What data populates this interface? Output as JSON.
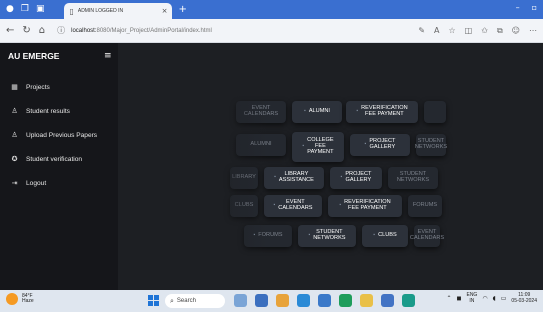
{
  "browser": {
    "tab_title": "ADMIN LOGGED IN",
    "new_tab_symbol": "+",
    "url_host": "localhost:",
    "url_path": "8080/Major_Project/AdminPortal/index.html"
  },
  "sidebar": {
    "brand": "AU EMERGE",
    "items": [
      {
        "icon": "grid-icon",
        "glyph": "▦",
        "label": "Projects"
      },
      {
        "icon": "user-icon",
        "glyph": "♙",
        "label": "Student results"
      },
      {
        "icon": "user-upload-icon",
        "glyph": "♙",
        "label": "Upload Previous Papers"
      },
      {
        "icon": "verify-icon",
        "glyph": "✪",
        "label": "Student verification"
      },
      {
        "icon": "logout-icon",
        "glyph": "⇥",
        "label": "Logout"
      }
    ]
  },
  "tiles": [
    {
      "label": "EVENT\nCALENDARS",
      "dim": true
    },
    {
      "label": "ALUMNI",
      "dim": false
    },
    {
      "label": "REVERIFICATION\nFEE PAYMENT",
      "dim": false
    },
    {
      "label": "ALUMNI",
      "dim": true
    },
    {
      "label": "COLLEGE\nFEE\nPAYMENT",
      "dim": false
    },
    {
      "label": "PROJECT\nGALLERY",
      "dim": false
    },
    {
      "label": "STUDENT\nNETWORKS",
      "dim": true
    },
    {
      "label": "LIBRARY",
      "dim": true
    },
    {
      "label": "LIBRARY\nASSISTANCE",
      "dim": false
    },
    {
      "label": "PROJECT\nGALLERY",
      "dim": false
    },
    {
      "label": "STUDENT\nNETWORKS",
      "dim": true
    },
    {
      "label": "CLUBS",
      "dim": true
    },
    {
      "label": "EVENT\nCALENDARS",
      "dim": false
    },
    {
      "label": "REVERIFICATION\nFEE PAYMENT",
      "dim": false
    },
    {
      "label": "FORUMS",
      "dim": true
    },
    {
      "label": "FORUMS",
      "dim": true
    },
    {
      "label": "STUDENT\nNETWORKS",
      "dim": false
    },
    {
      "label": "CLUBS",
      "dim": false
    },
    {
      "label": "EVENT\nCALENDARS",
      "dim": true
    }
  ],
  "taskbar": {
    "weather_temp": "84°F",
    "weather_desc": "Haze",
    "search_label": "Search",
    "lang_top": "ENG",
    "lang_bottom": "IN",
    "time": "11:09",
    "date": "05-03-2024"
  }
}
